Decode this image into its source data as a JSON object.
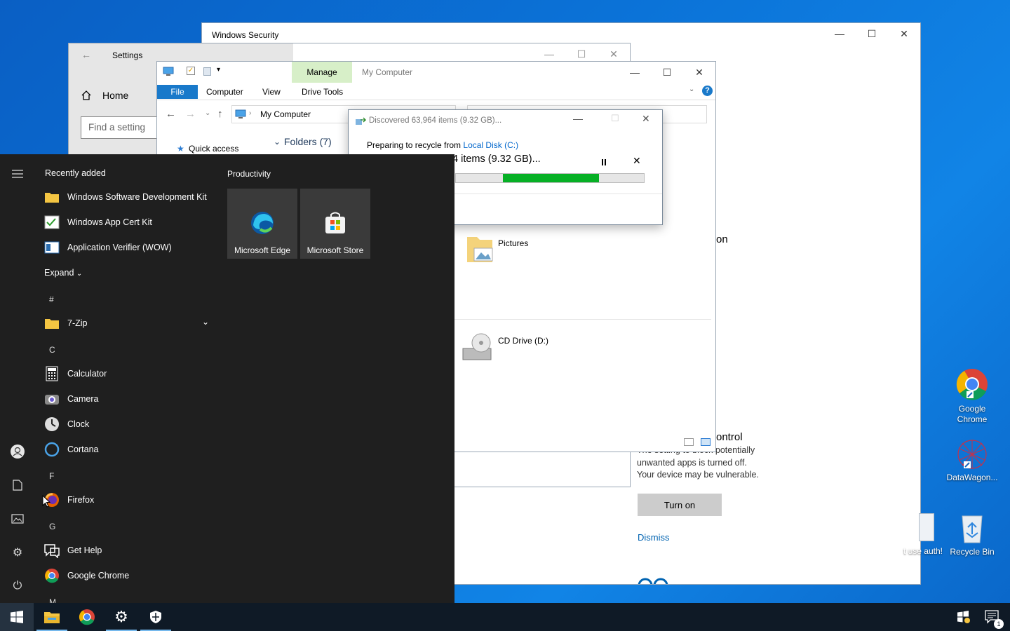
{
  "windows_security": {
    "title": "Windows Security",
    "partial_heading_1": "on",
    "partial_heading_2": "ontrol",
    "body_lines": [
      "The setting to block potentially",
      "unwanted apps is turned off.",
      "Your device may be vulnerable."
    ],
    "turn_on": "Turn on",
    "dismiss": "Dismiss"
  },
  "settings": {
    "title": "Settings",
    "home": "Home",
    "search_placeholder": "Find a setting"
  },
  "explorer": {
    "manage_tab": "Manage",
    "title": "My Computer",
    "tabs": [
      "File",
      "Computer",
      "View",
      "Drive Tools"
    ],
    "address": "My Computer",
    "nav_quick_access": "Quick access",
    "folders_header": "Folders (7)",
    "items": [
      {
        "name": "Pictures"
      },
      {
        "name": "CD Drive (D:)"
      }
    ]
  },
  "copy_dialog": {
    "title": "Discovered 63,964 items (9.32 GB)...",
    "preparing_text": "Preparing to recycle from",
    "source_link": "Local Disk (C:)",
    "status": "4 items (9.32 GB)...",
    "progress": 0.32,
    "colors": {
      "progress": "#06b025"
    }
  },
  "start_menu": {
    "recently_added_label": "Recently added",
    "recent": [
      {
        "label": "Windows Software Development Kit",
        "icon": "folder-icon"
      },
      {
        "label": "Windows App Cert Kit",
        "icon": "cert-icon"
      },
      {
        "label": "Application Verifier (WOW)",
        "icon": "app-verifier-icon"
      }
    ],
    "expand": "Expand",
    "sections": [
      {
        "letter": "#",
        "apps": [
          {
            "label": "7-Zip",
            "icon": "folder-icon"
          }
        ]
      },
      {
        "letter": "C",
        "apps": [
          {
            "label": "Calculator",
            "icon": "calculator-icon"
          },
          {
            "label": "Camera",
            "icon": "camera-icon"
          },
          {
            "label": "Clock",
            "icon": "clock-icon"
          },
          {
            "label": "Cortana",
            "icon": "cortana-icon"
          }
        ]
      },
      {
        "letter": "F",
        "apps": [
          {
            "label": "Firefox",
            "icon": "firefox-icon"
          }
        ]
      },
      {
        "letter": "G",
        "apps": [
          {
            "label": "Get Help",
            "icon": "help-icon"
          },
          {
            "label": "Google Chrome",
            "icon": "chrome-icon"
          }
        ]
      },
      {
        "letter": "M",
        "apps": []
      }
    ],
    "productivity_label": "Productivity",
    "tiles": [
      {
        "label": "Microsoft Edge",
        "icon": "edge-icon"
      },
      {
        "label": "Microsoft Store",
        "icon": "store-icon"
      }
    ]
  },
  "desktop_icons": [
    {
      "label": "Google Chrome",
      "icon": "chrome-icon"
    },
    {
      "label": "DataWagon...",
      "icon": "datawagon-icon"
    },
    {
      "label": "Recycle Bin",
      "icon": "recycle-bin-icon"
    },
    {
      "label": "t use auth!",
      "icon": "document-icon"
    }
  ],
  "taskbar": {
    "items": [
      "start-icon",
      "file-explorer-icon",
      "chrome-icon",
      "settings-icon",
      "windows-security-icon"
    ],
    "notification_count": "1"
  }
}
